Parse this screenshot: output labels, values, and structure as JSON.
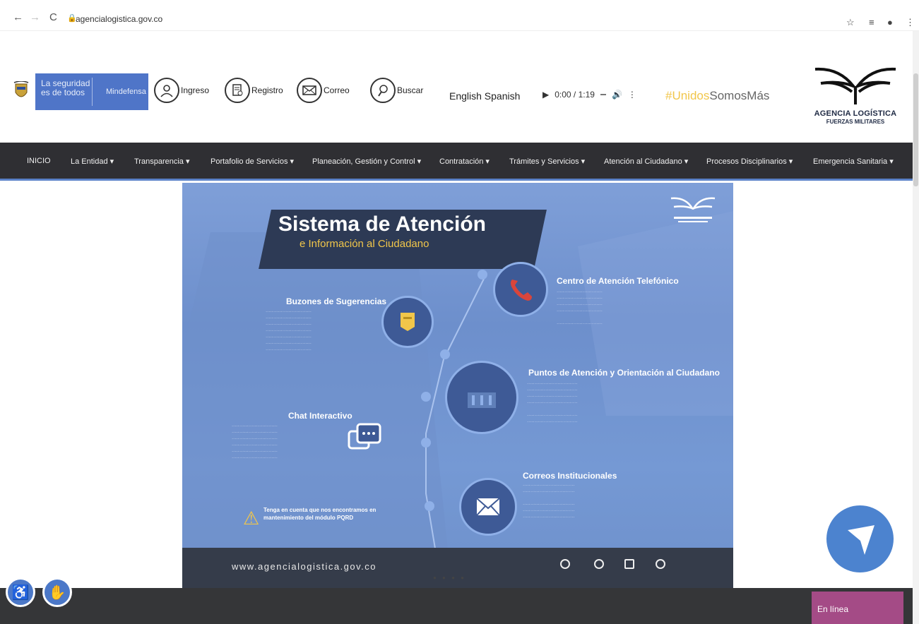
{
  "browser": {
    "url": "agencialogistica.gov.co"
  },
  "header": {
    "seguridad_line1": "La seguridad",
    "seguridad_line2": "es de todos",
    "mindefensa": "Mindefensa",
    "items": [
      {
        "label": "Ingreso",
        "icon": "user-icon"
      },
      {
        "label": "Registro",
        "icon": "form-icon"
      },
      {
        "label": "Correo",
        "icon": "mail-icon"
      },
      {
        "label": "Buscar",
        "icon": "search-hand-icon"
      }
    ],
    "languages": "English Spanish",
    "audio_time": "0:00 / 1:19",
    "hashtag_part1": "#Unidos",
    "hashtag_part2": "SomosMás",
    "logo_line1": "AGENCIA LOGÍSTICA",
    "logo_line2": "FUERZAS MILITARES",
    "brand_color": "#4f75c8",
    "hashtag_color": "#f1c64a"
  },
  "nav": {
    "items": [
      "INICIO",
      "La Entidad ▾",
      "Transparencia ▾",
      "Portafolio de Servicios ▾",
      "Planeación, Gestión y Control ▾",
      "Contratación ▾",
      "Trámites y Servicios ▾",
      "Atención al Ciudadano ▾",
      "Procesos Disciplinarios ▾",
      "Emergencia Sanitaria ▾"
    ]
  },
  "banner": {
    "title": "Sistema de Atención",
    "subtitle": "e Información al Ciudadano",
    "centro": "Centro de Atención Telefónico",
    "buzones": "Buzones de Sugerencias",
    "puntos": "Puntos de Atención y Orientación al Ciudadano",
    "chat": "Chat Interactivo",
    "correos": "Correos Institucionales",
    "warning": "Tenga en cuenta que nos encontramos en mantenimiento del módulo PQRD",
    "footer_url": "www.agencialogistica.gov.co"
  },
  "bottom": {
    "en_linea": "En línea"
  }
}
